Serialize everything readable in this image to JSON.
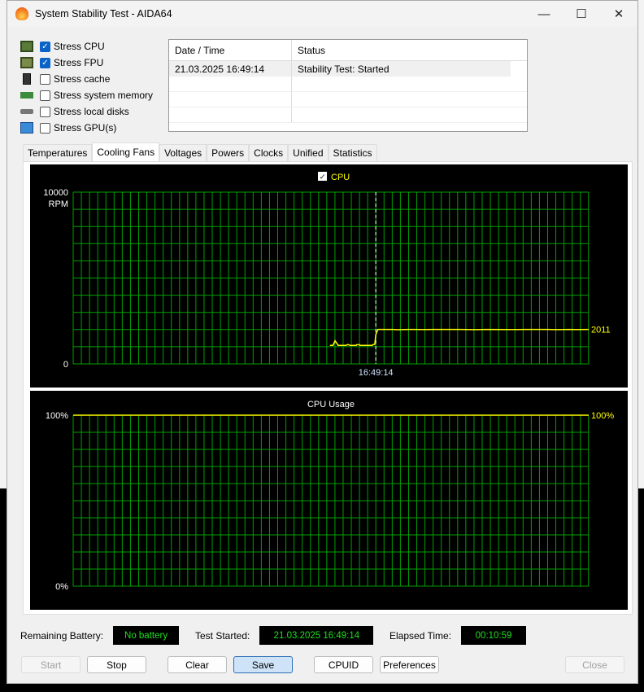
{
  "window": {
    "title": "System Stability Test - AIDA64",
    "minimize": "—",
    "maximize": "☐",
    "close": "✕"
  },
  "stress_options": [
    {
      "label": "Stress CPU",
      "checked": true,
      "icon": "cpu-icon"
    },
    {
      "label": "Stress FPU",
      "checked": true,
      "icon": "fpu-icon"
    },
    {
      "label": "Stress cache",
      "checked": false,
      "icon": "cache-icon"
    },
    {
      "label": "Stress system memory",
      "checked": false,
      "icon": "memory-icon"
    },
    {
      "label": "Stress local disks",
      "checked": false,
      "icon": "disk-icon"
    },
    {
      "label": "Stress GPU(s)",
      "checked": false,
      "icon": "gpu-icon"
    }
  ],
  "log": {
    "headers": [
      "Date / Time",
      "Status"
    ],
    "rows": [
      {
        "time": "21.03.2025 16:49:14",
        "status": "Stability Test: Started"
      }
    ]
  },
  "tabs": [
    "Temperatures",
    "Cooling Fans",
    "Voltages",
    "Powers",
    "Clocks",
    "Unified",
    "Statistics"
  ],
  "active_tab": 1,
  "chart_data": [
    {
      "type": "line",
      "title": "",
      "legend": [
        {
          "label": "CPU",
          "checked": true,
          "color": "#ffff00"
        }
      ],
      "ylabel": "RPM",
      "ylim": [
        0,
        10000
      ],
      "ytick_top": "10000",
      "ytick_bottom": "0",
      "xlim": [
        0,
        100
      ],
      "marker": {
        "x": 58.7,
        "label": "16:49:14"
      },
      "current_value": "2011",
      "series": [
        {
          "name": "CPU",
          "color": "#ffff00",
          "points": [
            [
              49.8,
              1080
            ],
            [
              50.4,
              1080
            ],
            [
              50.8,
              1350
            ],
            [
              51.4,
              1080
            ],
            [
              52.9,
              1080
            ],
            [
              53.3,
              1130
            ],
            [
              53.7,
              1080
            ],
            [
              54.9,
              1080
            ],
            [
              55.0,
              1120
            ],
            [
              55.5,
              1120
            ],
            [
              55.6,
              1080
            ],
            [
              58.0,
              1080
            ],
            [
              58.2,
              1130
            ],
            [
              58.5,
              1130
            ],
            [
              58.7,
              1700
            ],
            [
              59.1,
              2011
            ],
            [
              62,
              2011
            ],
            [
              63,
              1990
            ],
            [
              65,
              2011
            ],
            [
              68,
              2000
            ],
            [
              70,
              2011
            ],
            [
              75,
              2011
            ],
            [
              78,
              1995
            ],
            [
              80,
              2011
            ],
            [
              85,
              2000
            ],
            [
              88,
              2011
            ],
            [
              92,
              2011
            ],
            [
              94,
              1995
            ],
            [
              96,
              2011
            ],
            [
              98,
              2000
            ],
            [
              100,
              2011
            ]
          ]
        }
      ]
    },
    {
      "type": "line",
      "title": "CPU Usage",
      "ylim": [
        0,
        100
      ],
      "xlim": [
        0,
        100
      ],
      "ytick_top": "100%",
      "ytick_bottom": "0%",
      "current_value": "100%",
      "series": [
        {
          "name": "CPU Usage",
          "color": "#ffff00",
          "points": [
            [
              0,
              100
            ],
            [
              100,
              100
            ]
          ]
        }
      ]
    }
  ],
  "status": {
    "battery_label": "Remaining Battery:",
    "battery_value": "No battery",
    "started_label": "Test Started:",
    "started_value": "21.03.2025 16:49:14",
    "elapsed_label": "Elapsed Time:",
    "elapsed_value": "00:10:59"
  },
  "buttons": {
    "start": "Start",
    "stop": "Stop",
    "clear": "Clear",
    "save": "Save",
    "cpuid": "CPUID",
    "preferences": "Preferences",
    "close": "Close"
  }
}
